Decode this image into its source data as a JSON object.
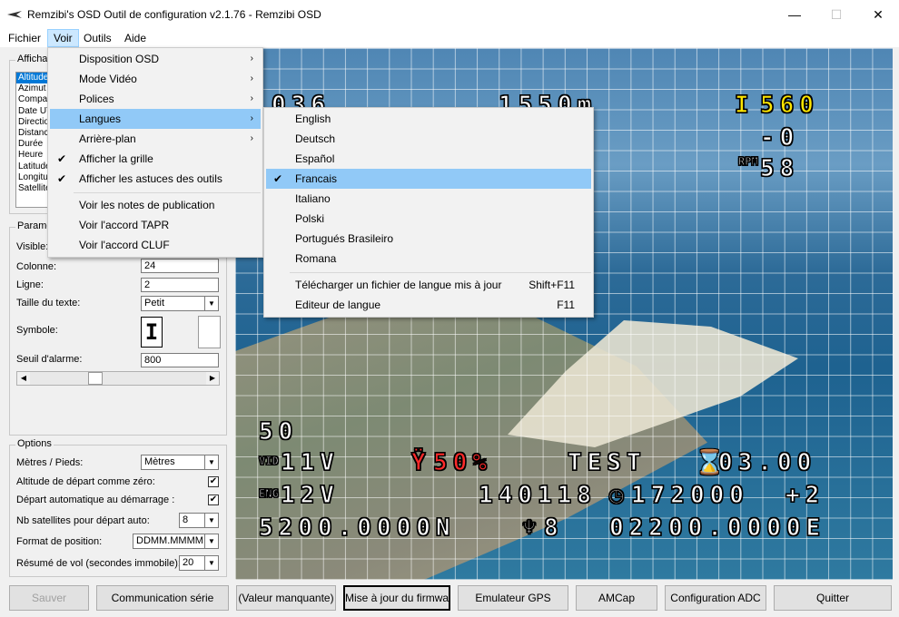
{
  "window": {
    "title": "Remzibi's OSD Outil de configuration v2.1.76 - Remzibi OSD",
    "minimize": "—",
    "maximize": "☐",
    "close": "✕"
  },
  "menubar": [
    "Fichier",
    "Voir",
    "Outils",
    "Aide"
  ],
  "left": {
    "display_group": "Affichage",
    "items": [
      "Altitude",
      "Azimut",
      "Compas",
      "Date UTC",
      "Direction",
      "Distance",
      "Durée",
      "Heure",
      "Latitude",
      "Longitude",
      "Satellites"
    ],
    "param_group": "Paramètres",
    "visible_label": "Visible:",
    "col_label": "Colonne:",
    "col_value": "24",
    "row_label": "Ligne:",
    "row_value": "2",
    "textsize_label": "Taille du texte:",
    "textsize_value": "Petit",
    "symbol_label": "Symbole:",
    "symbol_glyph": "I",
    "alarm_label": "Seuil d'alarme:",
    "alarm_value": "800",
    "options_group": "Options",
    "units_label": "Mètres / Pieds:",
    "units_value": "Mètres",
    "alt_zero_label": "Altitude de départ comme zéro:",
    "autostart_label": "Départ automatique au démarrage :",
    "sats_label": "Nb satellites pour départ auto:",
    "sats_value": "8",
    "pos_label": "Format de position:",
    "pos_value": "DDMM.MMMM",
    "resume_label": "Résumé de vol (secondes immobile):",
    "resume_value": "20"
  },
  "voir_menu": {
    "items": [
      "Disposition OSD",
      "Mode Vidéo",
      "Polices",
      "Langues",
      "Arrière-plan",
      "Afficher la grille",
      "Afficher les astuces des outils",
      "Voir les notes de publication",
      "Voir l'accord TAPR",
      "Voir l'accord CLUF"
    ]
  },
  "lang_menu": {
    "items": [
      "English",
      "Deutsch",
      "Español",
      "Francais",
      "Italiano",
      "Polski",
      "Portugués Brasileiro",
      "Romana"
    ],
    "download": "Télécharger un fichier de langue mis à jour",
    "download_sc": "Shift+F11",
    "editor": "Editeur de langue",
    "editor_sc": "F11"
  },
  "osd": {
    "top_left": "036",
    "top_mid": "1550m",
    "top_right_val": "560",
    "neg_zero": "-0",
    "rate": "58",
    "batt": "50",
    "v1": "11V",
    "pct": "50%",
    "test": "TEST",
    "timer": "03.00",
    "v2": "12V",
    "datetime": "140118",
    "time": "172000",
    "plus2": "+2",
    "lat": "5200.0000N",
    "sats": "8",
    "lon": "02200.0000E"
  },
  "buttons": [
    "Sauver",
    "Communication série",
    "(Valeur manquante)",
    "Mise à jour du firmware",
    "Emulateur GPS",
    "AMCap",
    "Configuration ADC",
    "Quitter"
  ]
}
